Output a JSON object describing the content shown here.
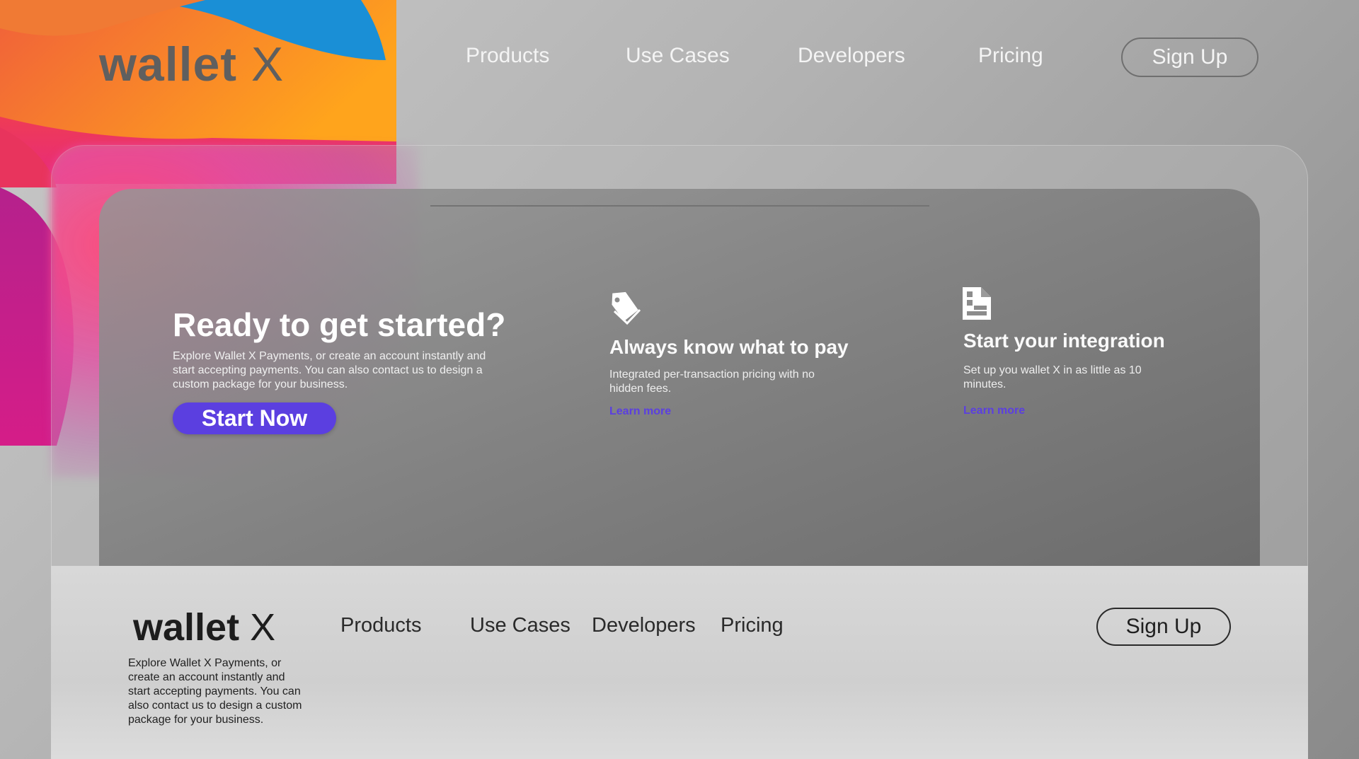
{
  "header": {
    "logo_main": "wallet",
    "logo_x": "X",
    "nav": [
      "Products",
      "Use Cases",
      "Developers",
      "Pricing"
    ],
    "signup_label": "Sign Up"
  },
  "cta": {
    "heading": "Ready to get started?",
    "text": "Explore Wallet X Payments, or create an account instantly and start accepting payments. You can also contact us to design a custom package for your business.",
    "button_label": "Start Now"
  },
  "features": [
    {
      "icon": "price-tag-icon",
      "title": "Always know what to pay",
      "text": "Integrated per-transaction pricing with no hidden fees.",
      "link": "Learn more"
    },
    {
      "icon": "document-icon",
      "title": "Start your integration",
      "text": "Set up you wallet X in as little as 10 minutes.",
      "link": "Learn more"
    }
  ],
  "footer": {
    "logo_main": "wallet",
    "logo_x": "X",
    "text": "Explore Wallet X Payments, or create an account instantly and start accepting payments. You can also contact us to design a custom package for your business.",
    "nav": [
      "Products",
      "Use Cases",
      "Developers",
      "Pricing"
    ],
    "signup_label": "Sign Up"
  },
  "colors": {
    "accent": "#5b3fe0",
    "blob_orange": "#ff8a1e",
    "blob_blue": "#1a8fd6",
    "blob_pink": "#e8306a",
    "blob_purple": "#b0208a"
  }
}
